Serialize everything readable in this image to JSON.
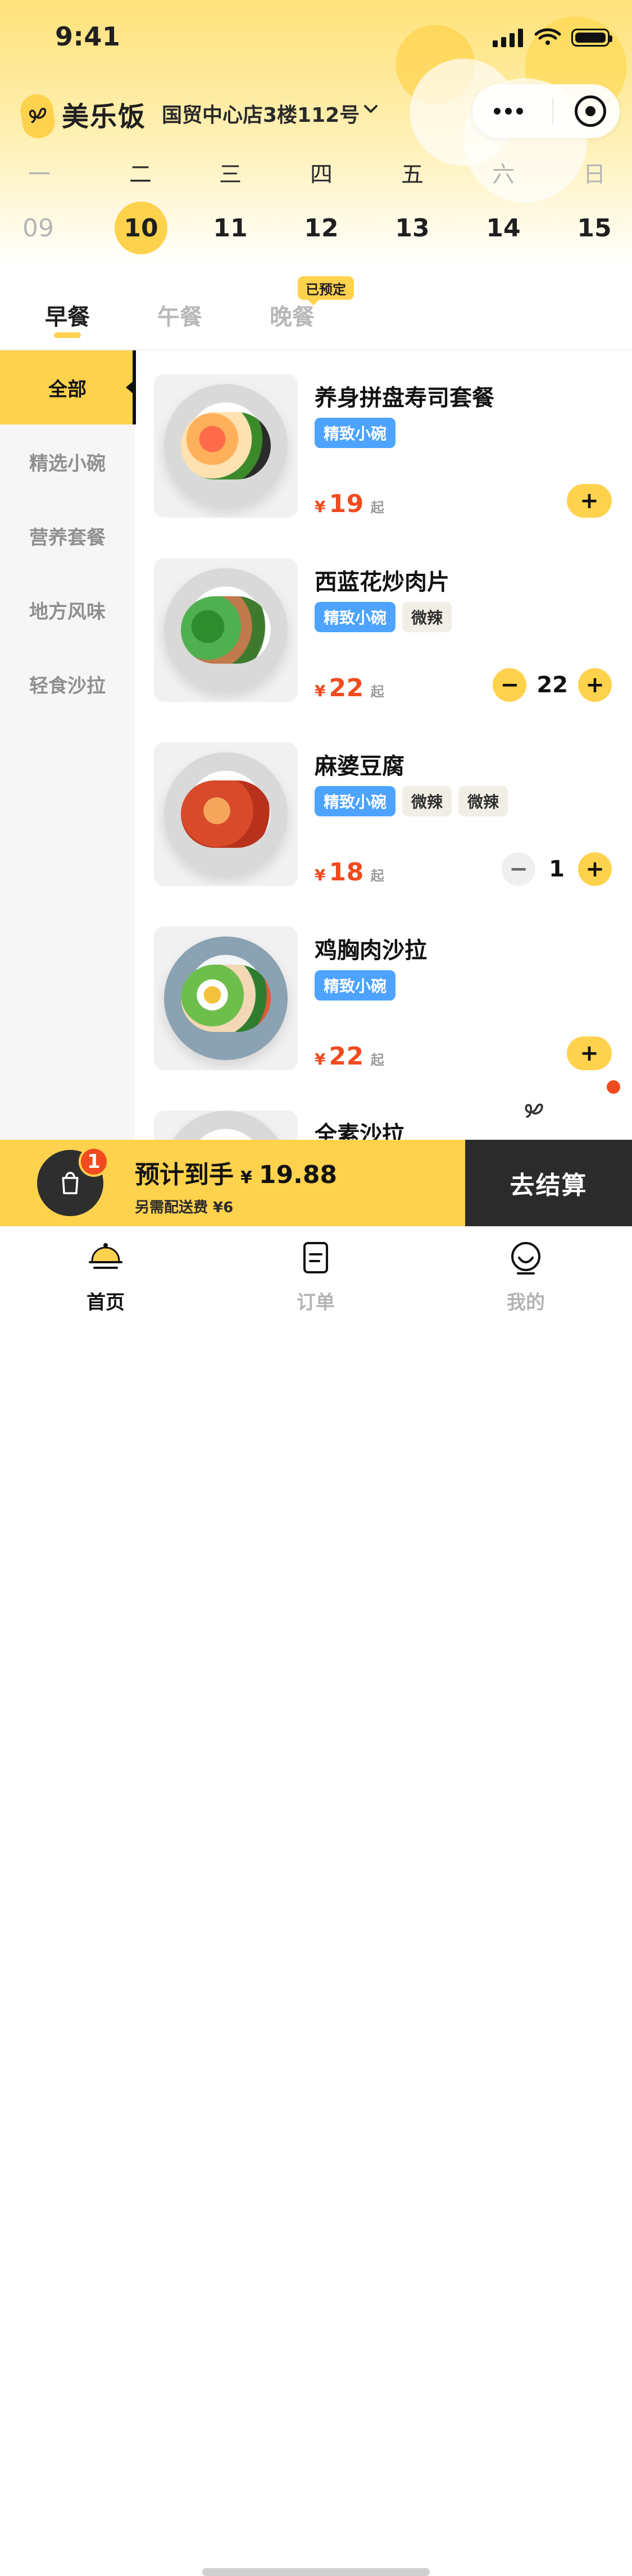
{
  "status_bar": {
    "time": "9:41"
  },
  "header": {
    "brand": "美乐饭",
    "store": "国贸中心店3楼112号"
  },
  "calendar": {
    "weekdays": [
      "一",
      "二",
      "三",
      "四",
      "五",
      "六",
      "日"
    ],
    "dates": [
      "09",
      "10",
      "11",
      "12",
      "13",
      "14",
      "15"
    ],
    "active_index": 1
  },
  "meal_tabs": {
    "tabs": [
      "早餐",
      "午餐",
      "晚餐"
    ],
    "active_index": 0,
    "reserved_badge": "已预定"
  },
  "sidebar": {
    "items": [
      "全部",
      "精选小碗",
      "营养套餐",
      "地方风味",
      "轻食沙拉"
    ],
    "active_index": 0
  },
  "menu": {
    "items": [
      {
        "name": "养身拼盘寿司套餐",
        "tags": [
          "精致小碗"
        ],
        "price": "19",
        "qi": "起",
        "currency": "¥",
        "control": "add",
        "colors": {
          "food": "#FF8A3D"
        }
      },
      {
        "name": "西蓝花炒肉片",
        "tags": [
          "精致小碗",
          "微辣"
        ],
        "price": "22",
        "qi": "起",
        "currency": "¥",
        "control": "stepper",
        "qty": "22",
        "colors": {
          "food": "#3CA43A"
        }
      },
      {
        "name": "麻婆豆腐",
        "tags": [
          "精致小碗",
          "微辣",
          "微辣"
        ],
        "price": "18",
        "qi": "起",
        "currency": "¥",
        "control": "stepper",
        "qty": "1",
        "colors": {
          "food": "#D74B2A"
        }
      },
      {
        "name": "鸡胸肉沙拉",
        "tags": [
          "精致小碗"
        ],
        "price": "22",
        "qi": "起",
        "currency": "¥",
        "control": "add",
        "colors": {
          "food": "#86C16E"
        }
      },
      {
        "name": "全素沙拉",
        "tags": [],
        "price": "",
        "qi": "",
        "currency": "",
        "control": "none",
        "colors": {
          "food": "#7BBF68"
        }
      }
    ]
  },
  "cart": {
    "badge_count": "1",
    "estimate_label": "预计到手",
    "estimate_currency": "¥",
    "estimate_amount": "19.88",
    "delivery_note": "另需配送费 ¥6",
    "checkout_label": "去结算"
  },
  "bottom_nav": {
    "items": [
      "首页",
      "订单",
      "我的"
    ],
    "active_index": 0
  },
  "icons": {
    "brand_logo": "le-logo",
    "location_chevron": "chevron-down-icon",
    "more": "more-icon",
    "target": "target-icon",
    "bag": "shopping-bag-icon",
    "home": "bell-dish-icon",
    "orders": "document-icon",
    "profile": "user-icon"
  },
  "theme": {
    "accent": "#FFD24D",
    "price": "#F04B1E",
    "tag_blue": "#4DA3FF",
    "dark": "#2B2B2B"
  }
}
